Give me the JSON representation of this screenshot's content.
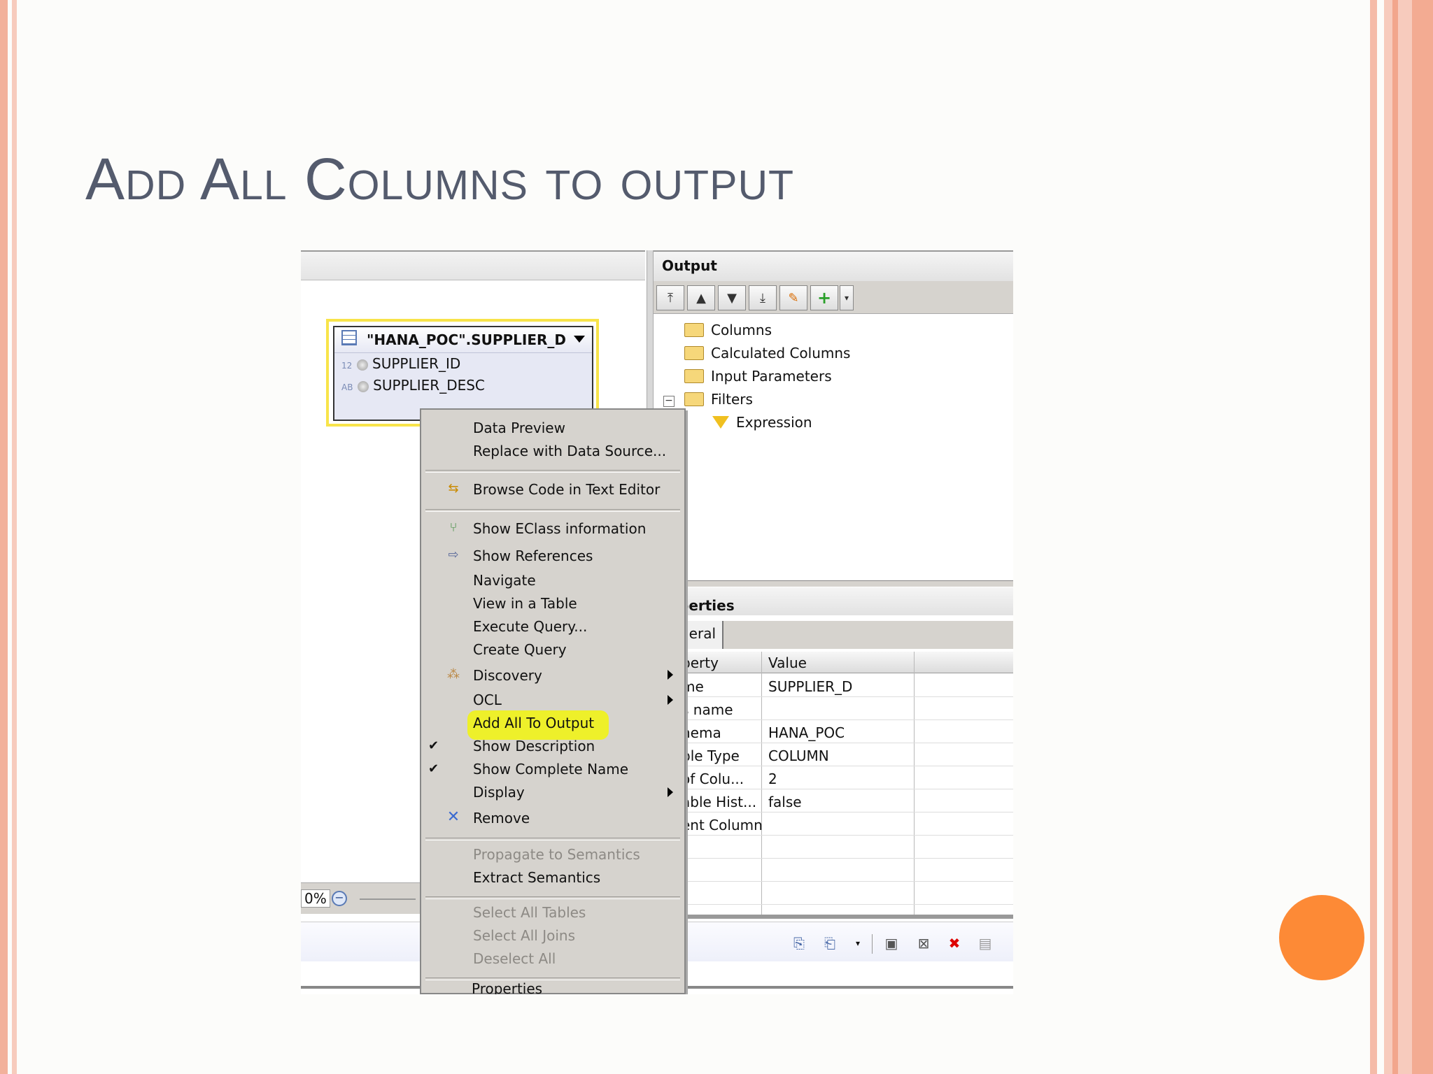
{
  "slide": {
    "title": "Add All Columns to output",
    "colors": {
      "accent_circle": "#fd8a36",
      "border_pink": "#f2b19b",
      "title_gray": "#545b6d",
      "highlight": "#eef02a"
    }
  },
  "output_panel": {
    "title": "Output",
    "toolbar_icons": [
      "move-top-icon",
      "move-up-icon",
      "move-down-icon",
      "move-bottom-icon",
      "edit-icon",
      "add-icon",
      "dropdown-icon"
    ],
    "tree": [
      {
        "label": "Columns",
        "icon": "folder-icon"
      },
      {
        "label": "Calculated Columns",
        "icon": "folder-icon"
      },
      {
        "label": "Input Parameters",
        "icon": "folder-icon"
      },
      {
        "label": "Filters",
        "icon": "folder-icon",
        "expanded": true
      },
      {
        "label": "Expression",
        "icon": "filter-icon"
      }
    ]
  },
  "table_node": {
    "title": "\"HANA_POC\".SUPPLIER_D",
    "columns": [
      {
        "type_tag": "12",
        "name": "SUPPLIER_ID"
      },
      {
        "type_tag": "AB",
        "name": "SUPPLIER_DESC"
      }
    ]
  },
  "zoom": {
    "value": "0%"
  },
  "context_menu": {
    "items": [
      {
        "label": "Data Preview"
      },
      {
        "label": "Replace with Data Source..."
      },
      {
        "label": "Browse Code in Text Editor",
        "icon": "browse-code-icon"
      },
      {
        "label": "Show EClass information",
        "icon": "eclass-icon"
      },
      {
        "label": "Show References",
        "icon": "references-icon"
      },
      {
        "label": "Navigate"
      },
      {
        "label": "View in a Table"
      },
      {
        "label": "Execute Query..."
      },
      {
        "label": "Create Query"
      },
      {
        "label": "Discovery",
        "icon": "discovery-icon",
        "submenu": true
      },
      {
        "label": "OCL",
        "submenu": true
      },
      {
        "label": "Add All To Output",
        "highlighted": true
      },
      {
        "label": "Show Description",
        "checked": true
      },
      {
        "label": "Show Complete Name",
        "checked": true
      },
      {
        "label": "Display",
        "submenu": true
      },
      {
        "label": "Remove",
        "icon": "remove-icon"
      },
      {
        "label": "Propagate to Semantics",
        "disabled": true
      },
      {
        "label": "Extract Semantics"
      },
      {
        "label": "Select All Tables",
        "disabled": true
      },
      {
        "label": "Select All Joins",
        "disabled": true
      },
      {
        "label": "Deselect All",
        "disabled": true
      },
      {
        "label": "Properties"
      }
    ]
  },
  "properties_panel": {
    "title": "perties",
    "tab": "neral",
    "headers": [
      "perty",
      "Value"
    ],
    "rows": [
      {
        "property": "me",
        "value": "SUPPLIER_D"
      },
      {
        "property": "s name",
        "value": ""
      },
      {
        "property": "hema",
        "value": "HANA_POC"
      },
      {
        "property": "ble Type",
        "value": "COLUMN"
      },
      {
        "property": "of Colu...",
        "value": "2"
      },
      {
        "property": "able Hist...",
        "value": "false"
      },
      {
        "property": "ent Column",
        "value": ""
      }
    ]
  },
  "bottom_toolbar_icons": [
    "import-icon",
    "export-icon",
    "dropdown-icon",
    "validate-icon",
    "delete-rows-icon",
    "delete-icon",
    "document-icon"
  ]
}
